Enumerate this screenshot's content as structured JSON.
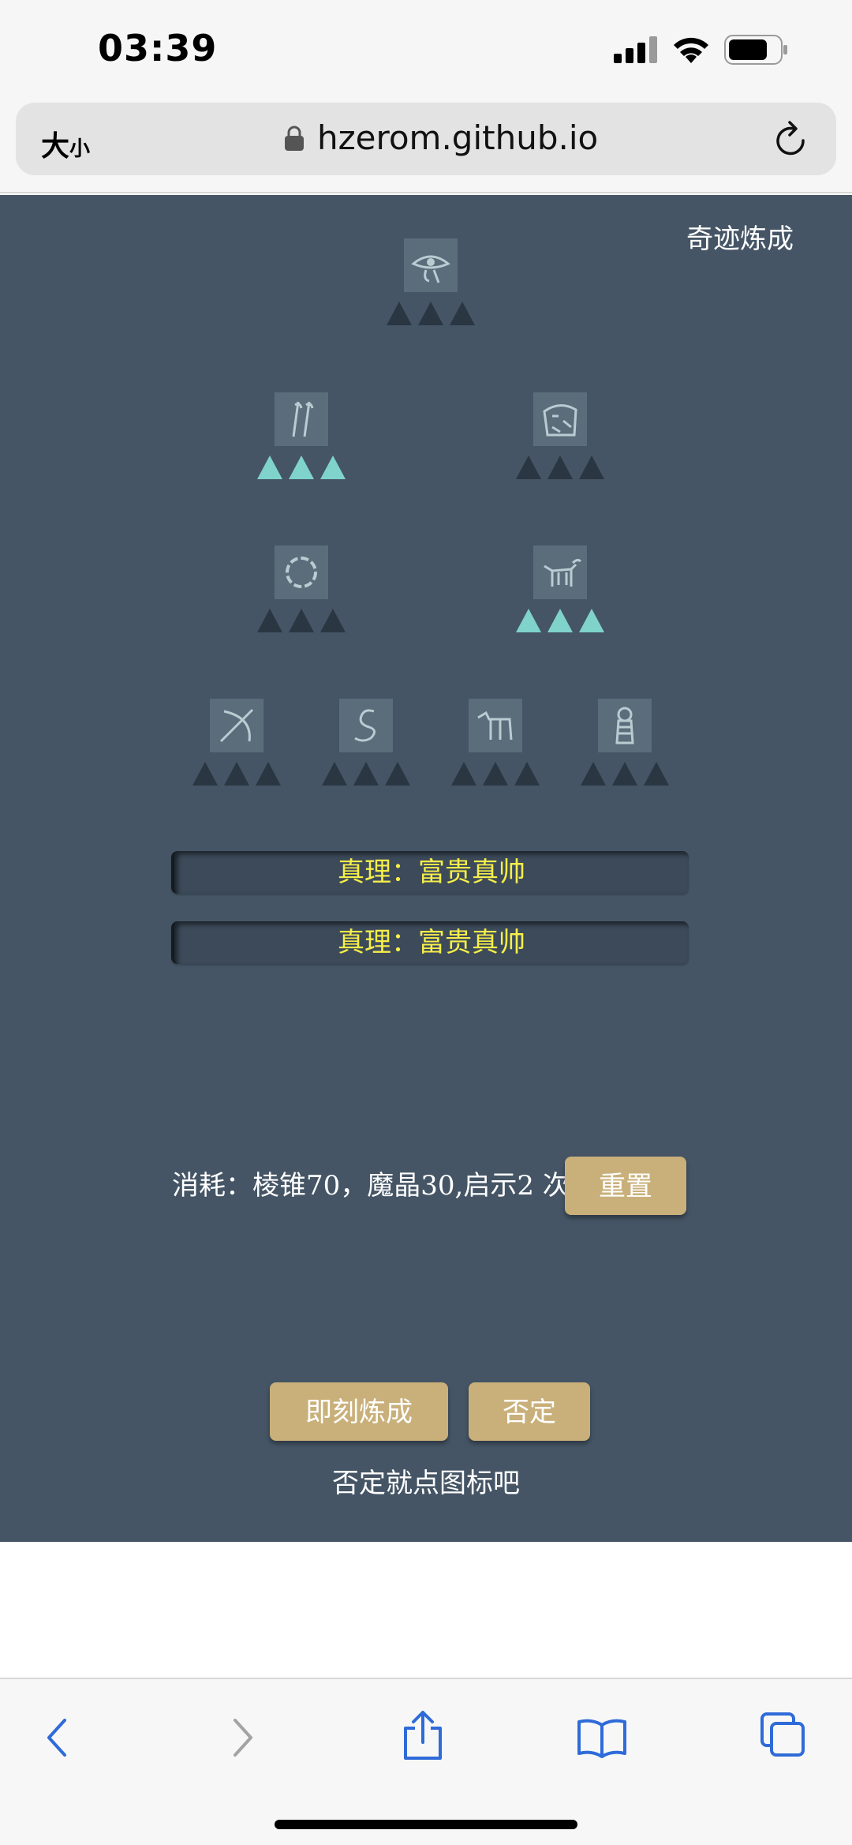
{
  "status_bar": {
    "time": "03:39",
    "icons": [
      "signal-icon",
      "wifi-icon",
      "battery-icon"
    ]
  },
  "browser": {
    "text_size_big": "大",
    "text_size_small": "小",
    "url": "hzerom.github.io",
    "icons": [
      "lock-icon",
      "reload-icon"
    ]
  },
  "app": {
    "title": "奇迹炼成",
    "glyphs": [
      {
        "name": "eye-of-horus",
        "active": false
      },
      {
        "name": "reeds",
        "active": true
      },
      {
        "name": "lion-head",
        "active": false
      },
      {
        "name": "ring",
        "active": false
      },
      {
        "name": "bull",
        "active": true
      },
      {
        "name": "bow-arrow",
        "active": false
      },
      {
        "name": "serpent",
        "active": false
      },
      {
        "name": "jackal",
        "active": false
      },
      {
        "name": "mummy",
        "active": false
      }
    ],
    "truth_1": "真理：富贵真帅",
    "truth_2": "真理：富贵真帅",
    "cost": "消耗：棱锥70，魔晶30,启示2 次",
    "reset_label": "重置",
    "alchemy_label": "即刻炼成",
    "deny_label": "否定",
    "hint": "否定就点图标吧",
    "colors": {
      "background": "#455565",
      "button": "#c9b07a",
      "truth_text": "#f6ee4a",
      "active_triangle": "#7fd3cb",
      "inactive_triangle": "#2a3642"
    }
  },
  "toolbar": {
    "icons": [
      "back-icon",
      "forward-icon",
      "share-icon",
      "bookmarks-icon",
      "tabs-icon"
    ]
  }
}
